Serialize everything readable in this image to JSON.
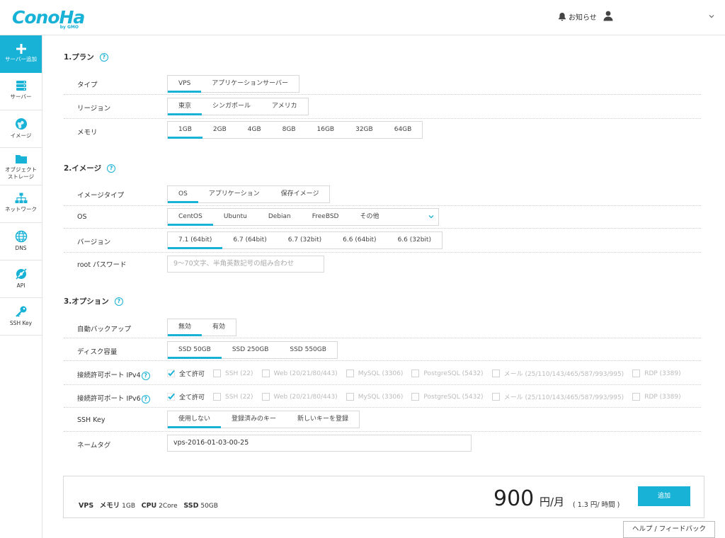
{
  "header": {
    "logo": "ConoHa",
    "logo_sub": "by GMO",
    "notice_label": "お知らせ"
  },
  "sidebar": {
    "items": [
      {
        "label": "サーバー追加",
        "icon": "plus-icon"
      },
      {
        "label": "サーバー",
        "icon": "server-icon"
      },
      {
        "label": "イメージ",
        "icon": "image-icon"
      },
      {
        "label": "オブジェクト\nストレージ",
        "label_1": "オブジェクト",
        "label_2": "ストレージ",
        "icon": "folder-icon"
      },
      {
        "label": "ネットワーク",
        "icon": "network-icon"
      },
      {
        "label": "DNS",
        "icon": "globe-icon"
      },
      {
        "label": "API",
        "icon": "api-icon"
      },
      {
        "label": "SSH Key",
        "icon": "key-icon"
      }
    ]
  },
  "plan": {
    "title": "1.プラン",
    "type_label": "タイプ",
    "type_options": [
      "VPS",
      "アプリケーションサーバー"
    ],
    "region_label": "リージョン",
    "region_options": [
      "東京",
      "シンガポール",
      "アメリカ"
    ],
    "memory_label": "メモリ",
    "memory_options": [
      "1GB",
      "2GB",
      "4GB",
      "8GB",
      "16GB",
      "32GB",
      "64GB"
    ]
  },
  "image": {
    "title": "2.イメージ",
    "image_type_label": "イメージタイプ",
    "image_type_options": [
      "OS",
      "アプリケーション",
      "保存イメージ"
    ],
    "os_label": "OS",
    "os_options": [
      "CentOS",
      "Ubuntu",
      "Debian",
      "FreeBSD",
      "その他"
    ],
    "version_label": "バージョン",
    "version_options": [
      "7.1 (64bit)",
      "6.7 (64bit)",
      "6.7 (32bit)",
      "6.6 (64bit)",
      "6.6 (32bit)"
    ],
    "root_password_label": "root パスワード",
    "root_password_placeholder": "9～70文字、半角英数記号の組み合わせ"
  },
  "options": {
    "title": "3.オプション",
    "backup_label": "自動バックアップ",
    "backup_options": [
      "無効",
      "有効"
    ],
    "disk_label": "ディスク容量",
    "disk_options": [
      "SSD 50GB",
      "SSD 250GB",
      "SSD 550GB"
    ],
    "ipv4_label": "接続許可ポート IPv4",
    "ipv6_label": "接続許可ポート IPv6",
    "ports": [
      "全て許可",
      "SSH (22)",
      "Web (20/21/80/443)",
      "MySQL (3306)",
      "PostgreSQL (5432)",
      "メール (25/110/143/465/587/993/995)",
      "RDP (3389)"
    ],
    "sshkey_label": "SSH Key",
    "sshkey_options": [
      "使用しない",
      "登録済みのキー",
      "新しいキーを登録"
    ],
    "nametag_label": "ネームタグ",
    "nametag_value": "vps-2016-01-03-00-25"
  },
  "summary": {
    "type_key": "VPS",
    "memory_key": "メモリ",
    "memory_value": "1GB",
    "cpu_key": "CPU",
    "cpu_value": "2Core",
    "ssd_key": "SSD",
    "ssd_value": "50GB",
    "price": "900",
    "price_unit": "円/月",
    "price_hour": "( 1.3 円/ 時間 )",
    "add_label": "追加"
  },
  "help_feedback": "ヘルプ / フィードバック",
  "colors": {
    "accent": "#18b2d6"
  }
}
